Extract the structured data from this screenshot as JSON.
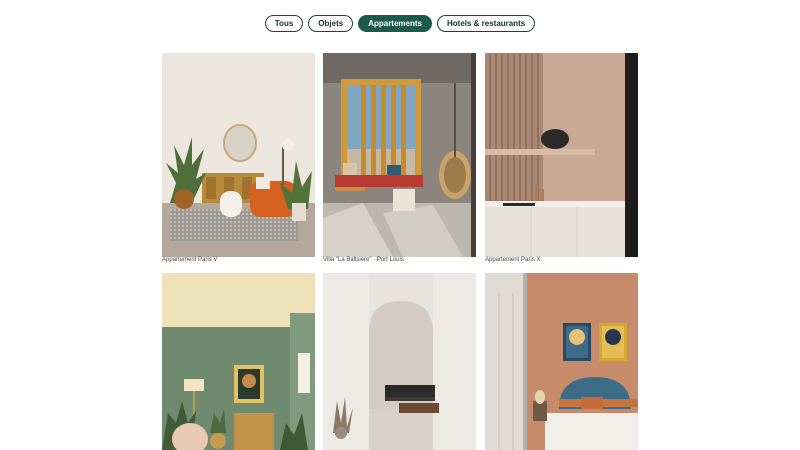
{
  "filters": {
    "items": [
      {
        "label": "Tous",
        "active": false
      },
      {
        "label": "Objets",
        "active": false
      },
      {
        "label": "Appartements",
        "active": true
      },
      {
        "label": "Hotels & restaurants",
        "active": false
      }
    ]
  },
  "gallery": {
    "items": [
      {
        "caption": "Appartement Paris V"
      },
      {
        "caption": "Villa \"La Ballsiere\" - Port Louis"
      },
      {
        "caption": "Appartement Paris X"
      },
      {
        "caption": ""
      },
      {
        "caption": ""
      },
      {
        "caption": ""
      }
    ]
  },
  "colors": {
    "accent": "#1d5a4c",
    "chip_border": "#2c3b34",
    "caption_text": "#444444"
  }
}
